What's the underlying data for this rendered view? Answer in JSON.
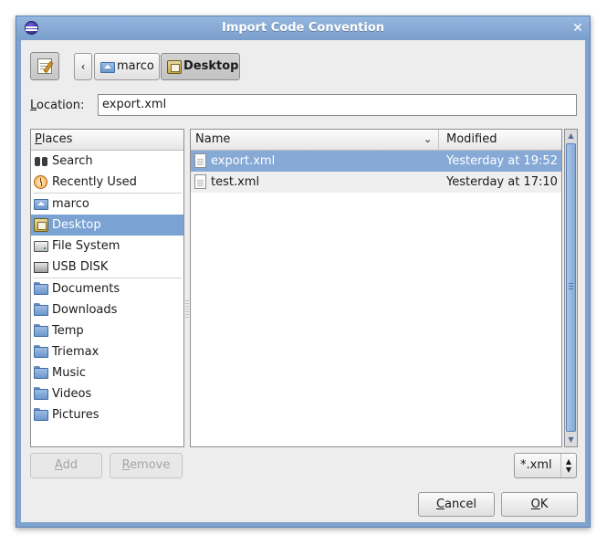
{
  "window": {
    "title": "Import Code Convention",
    "close_glyph": "✕"
  },
  "toolbar": {
    "path_back_glyph": "‹",
    "path": [
      {
        "label": "marco",
        "icon": "home-folder-icon"
      },
      {
        "label": "Desktop",
        "icon": "desktop-icon",
        "active": true
      }
    ]
  },
  "location": {
    "label_prefix": "L",
    "label_rest": "ocation:",
    "value": "export.xml"
  },
  "places": {
    "header_prefix": "P",
    "header_rest": "laces",
    "groups": [
      [
        {
          "label": "Search",
          "icon": "binoculars-icon"
        },
        {
          "label": "Recently Used",
          "icon": "clock-icon"
        }
      ],
      [
        {
          "label": "marco",
          "icon": "home-folder-icon"
        },
        {
          "label": "Desktop",
          "icon": "desktop-icon",
          "selected": true
        },
        {
          "label": "File System",
          "icon": "drive-icon"
        },
        {
          "label": "USB DISK",
          "icon": "usb-drive-icon"
        }
      ],
      [
        {
          "label": "Documents",
          "icon": "folder-icon"
        },
        {
          "label": "Downloads",
          "icon": "folder-icon"
        },
        {
          "label": "Temp",
          "icon": "folder-icon"
        },
        {
          "label": "Triemax",
          "icon": "folder-icon"
        },
        {
          "label": "Music",
          "icon": "folder-icon"
        },
        {
          "label": "Videos",
          "icon": "folder-icon"
        },
        {
          "label": "Pictures",
          "icon": "folder-icon"
        }
      ]
    ]
  },
  "files": {
    "columns": {
      "name": "Name",
      "modified": "Modified",
      "sort_glyph": "⌄"
    },
    "rows": [
      {
        "name": "export.xml",
        "modified": "Yesterday at 19:52",
        "selected": true
      },
      {
        "name": "test.xml",
        "modified": "Yesterday at 17:10"
      }
    ]
  },
  "scrollbar": {
    "up_glyph": "▲",
    "down_glyph": "▼",
    "grip_glyph": "≡"
  },
  "buttons": {
    "add_prefix": "A",
    "add_rest": "dd",
    "remove_prefix": "R",
    "remove_rest": "emove",
    "cancel_prefix": "C",
    "cancel_rest": "ancel",
    "ok_prefix": "O",
    "ok_rest": "K"
  },
  "filter": {
    "value": "*.xml",
    "updown_up": "▲",
    "updown_down": "▼"
  },
  "colors": {
    "selection": "#7aa2d3",
    "titlebar": "#7fa3cf"
  }
}
